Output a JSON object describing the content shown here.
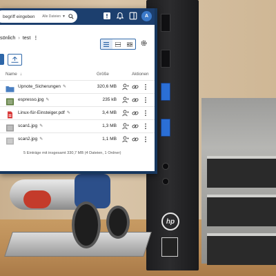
{
  "search": {
    "text": "begriff eingeben",
    "scope": "Alle Dateien"
  },
  "user": {
    "avatar_initial": "A"
  },
  "breadcrumb": {
    "parent": "sönlich",
    "current": "test"
  },
  "table": {
    "headers": {
      "name": "Name",
      "size": "Größe",
      "actions": "Aktionen"
    },
    "rows": [
      {
        "name": "Upnote_Sicherungen",
        "size": "320,6 MB",
        "type": "folder-icon",
        "color": "#4a7fc1"
      },
      {
        "name": "espresso.jpg",
        "size": "235 kB",
        "type": "image-icon",
        "color": "#5a7a3a"
      },
      {
        "name": "Linux-für-Einsteiger.pdf",
        "size": "3,4 MB",
        "type": "pdf-icon",
        "color": "#d93a3a"
      },
      {
        "name": "scan1.jpg",
        "size": "1,3 MB",
        "type": "image-icon",
        "color": "#9a9a9a"
      },
      {
        "name": "scan2.jpg",
        "size": "1,1 MB",
        "type": "image-icon",
        "color": "#b0b0b0"
      }
    ]
  },
  "footer": {
    "summary": "5 Einträge mit insgesamt 330,7 MB (4 Dateien, 1 Ordner)"
  },
  "colors": {
    "topbar": "#1c3f6e",
    "accent": "#2d66a8"
  }
}
